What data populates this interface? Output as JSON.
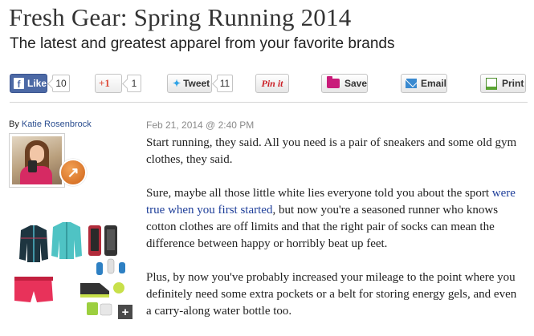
{
  "article": {
    "title": "Fresh Gear: Spring Running 2014",
    "subtitle": "The latest and greatest apparel from your favorite brands"
  },
  "share_bar": {
    "facebook": {
      "icon": "facebook-icon",
      "label": "Like",
      "count": "10"
    },
    "google_plus": {
      "icon": "google-plus-icon",
      "label": "+1",
      "count": "1"
    },
    "twitter": {
      "icon": "twitter-bird-icon",
      "label": "Tweet",
      "count": "11"
    },
    "pinterest": {
      "label": "Pin it"
    },
    "save": {
      "icon": "folder-icon",
      "label": "Save"
    },
    "email": {
      "icon": "envelope-icon",
      "label": "Email"
    },
    "print": {
      "icon": "printer-icon",
      "label": "Print"
    },
    "colors": {
      "facebook": "#4c69a5",
      "google_plus": "#dd4b39",
      "twitter": "#2fa3e6",
      "pinterest": "#cb2027",
      "save": "#c91c7a",
      "email": "#3a8ad0",
      "print": "#5aa531"
    }
  },
  "byline": {
    "prefix": "By",
    "author": "Katie Rosenbrock"
  },
  "dateline": "Feb 21, 2014 @ 2:40 PM",
  "badge_icon": "runner-icon",
  "gallery": {
    "expand_label": "+"
  },
  "body": {
    "p1": "Start running, they said. All you need is a pair of sneakers and some old gym clothes, they said.",
    "p2_before": "Sure, maybe all those little white lies everyone told you about the sport ",
    "p2_link": "were true when you first started",
    "p2_after": ", but now you're a seasoned runner who knows cotton clothes are off limits and that the right pair of socks can mean the difference between happy or horribly beat up feet.",
    "p3": "Plus, by now you've probably increased your mileage to the point where you definitely need some extra pockets or a belt for storing energy gels, and even a carry-along water bottle too."
  }
}
